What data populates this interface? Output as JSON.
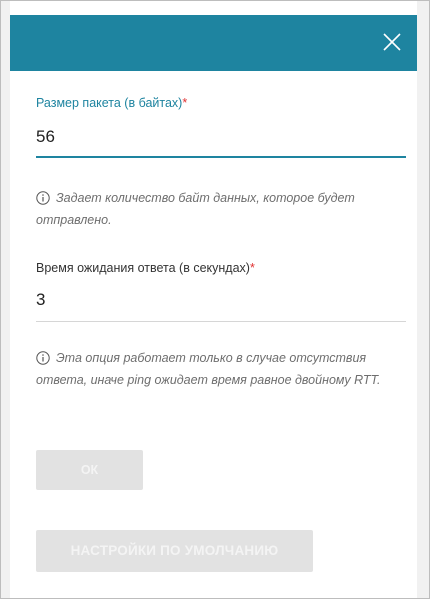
{
  "dialog": {
    "close_icon": "close-icon"
  },
  "packet_size": {
    "label": "Размер пакета (в байтах)",
    "required_mark": "*",
    "value": "56",
    "hint": "Задает количество байт данных, которое будет отправлено."
  },
  "timeout": {
    "label": "Время ожидания ответа (в секундах)",
    "required_mark": "*",
    "value": "3",
    "hint": "Эта опция работает только в случае отсутствия ответа, иначе ping ожидает время равное двойному RTT."
  },
  "buttons": {
    "ok_label": "ОК",
    "default_label": "НАСТРОЙКИ ПО УМОЛЧАНИЮ"
  },
  "colors": {
    "header": "#1e84a0",
    "accent": "#1e84a0",
    "required": "#e03030",
    "button_disabled": "#e2e2e2"
  }
}
